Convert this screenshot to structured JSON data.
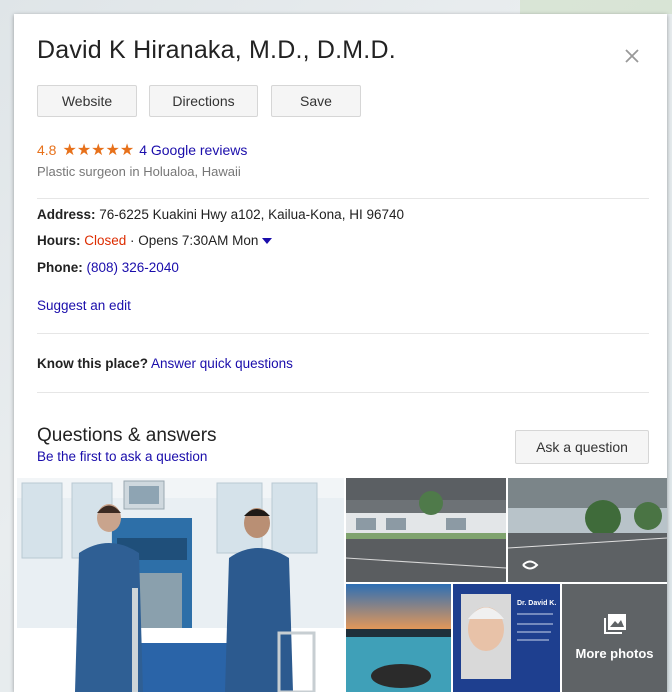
{
  "place": {
    "name": "David K Hiranaka, M.D., D.M.D.",
    "rating": "4.8",
    "stars": "★★★★★",
    "reviews_link": "4 Google reviews",
    "category": "Plastic surgeon in Holualoa, Hawaii"
  },
  "actions": {
    "website": "Website",
    "directions": "Directions",
    "save": "Save"
  },
  "info": {
    "address_label": "Address:",
    "address_value": "76-6225 Kuakini Hwy a102, Kailua-Kona, HI 96740",
    "hours_label": "Hours:",
    "hours_status": "Closed",
    "hours_detail": " · Opens 7:30AM Mon",
    "phone_label": "Phone:",
    "phone_value": "(808) 326-2040",
    "suggest_edit": "Suggest an edit"
  },
  "know": {
    "label": "Know this place?",
    "link": "Answer quick questions"
  },
  "qa": {
    "title": "Questions & answers",
    "subtitle": "Be the first to ask a question",
    "ask_button": "Ask a question"
  },
  "photos": {
    "more_label": "More photos",
    "card_text": "Dr. David K."
  },
  "colors": {
    "link": "#1a0dab",
    "rating": "#e7711b",
    "closed": "#dd2c00"
  }
}
